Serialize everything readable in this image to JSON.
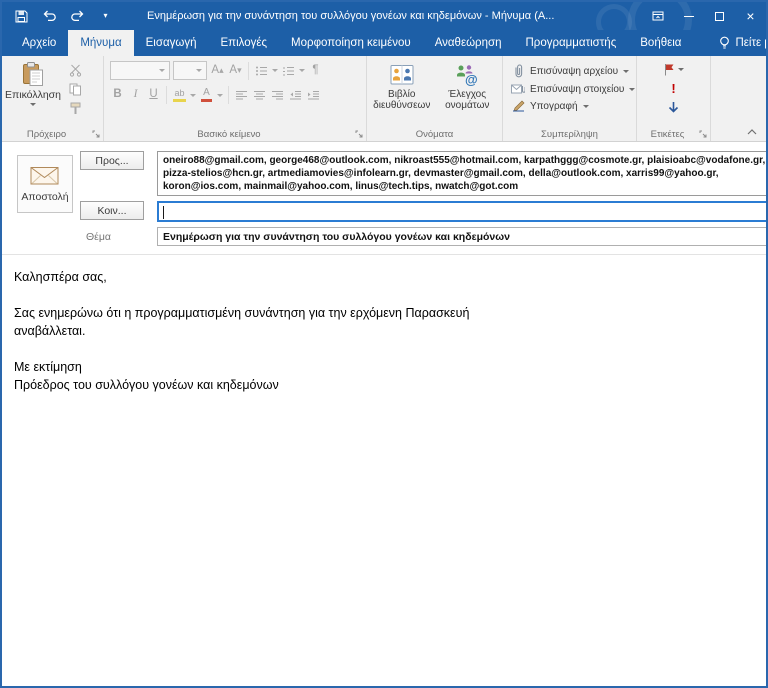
{
  "window": {
    "title": "Ενημέρωση για την συνάντηση του συλλόγου γονέων και κηδεμόνων  -  Μήνυμα (Α..."
  },
  "tabs": [
    {
      "label": "Αρχείο"
    },
    {
      "label": "Μήνυμα"
    },
    {
      "label": "Εισαγωγή"
    },
    {
      "label": "Επιλογές"
    },
    {
      "label": "Μορφοποίηση κειμένου"
    },
    {
      "label": "Αναθεώρηση"
    },
    {
      "label": "Προγραμματιστής"
    },
    {
      "label": "Βοήθεια"
    },
    {
      "label": "Πείτε μου"
    }
  ],
  "ribbon": {
    "clipboard": {
      "group_label": "Πρόχειρο",
      "paste_label": "Επικόλληση"
    },
    "basic_text": {
      "group_label": "Βασικό κείμενο"
    },
    "names": {
      "group_label": "Ονόματα",
      "address_book_label": "Βιβλίο διευθύνσεων",
      "check_names_label": "Έλεγχος ονομάτων"
    },
    "include": {
      "group_label": "Συμπερίληψη",
      "attach_file_label": "Επισύναψη αρχείου",
      "attach_item_label": "Επισύναψη στοιχείου",
      "signature_label": "Υπογραφή"
    },
    "tags": {
      "group_label": "Ετικέτες"
    }
  },
  "compose": {
    "send_label": "Αποστολή",
    "to_button": "Προς...",
    "to_lines": [
      "oneiro88@gmail.com, george468@outlook.com, nikroast555@hotmail.com, karpathggg@cosmote.gr, plaisioabc@vodafone.gr,",
      "pizza-stelios@hcn.gr, artmediamovies@infolearn.gr, devmaster@gmail.com, della@outlook.com, xarris99@yahoo.gr,",
      "koron@ios.com, mainmail@yahoo.com, linus@tech.tips, nwatch@got.com"
    ],
    "cc_button": "Κοιν...",
    "cc_value": "",
    "subject_label": "Θέμα",
    "subject_value": "Ενημέρωση για την συνάντηση του συλλόγου γονέων και κηδεμόνων"
  },
  "body": {
    "lines": [
      "Καλησπέρα σας,",
      "",
      "Σας ενημερώνω ότι η προγραμματισμένη συνάντηση για την ερχόμενη Παρασκευή",
      "αναβάλλεται.",
      "",
      "Με εκτίμηση",
      "Πρόεδρος του συλλόγου γονέων και κηδεμόνων"
    ]
  },
  "colors": {
    "titlebar_blue": "#1d5fa7",
    "window_border": "#2a67ad",
    "ribbon_bg": "#f1f1f1",
    "focus_border": "#2b7cd3",
    "flag_red": "#c0392b",
    "importance_red": "#c00000",
    "arrow_blue": "#2b579a"
  }
}
